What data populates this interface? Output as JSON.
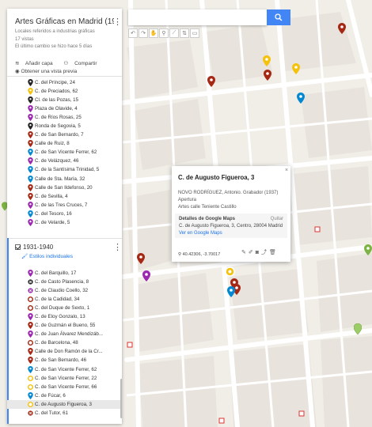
{
  "panel": {
    "title": "Artes Gráficas en Madrid (1900-1...",
    "subtitle": "Locales referidos a industrias gráficas",
    "views": "17 vistas",
    "last_change": "El último cambio se hizo hace 5 días",
    "add_layer": "Añadir capa",
    "share": "Compartir",
    "preview": "Obtener una vista previa"
  },
  "layer1": {
    "items": [
      {
        "label": "C. del Príncipe, 24",
        "color": "#222222"
      },
      {
        "label": "C. de Preciados, 62",
        "color": "#f4c20d"
      },
      {
        "label": "Cl. de las Pozas, 15",
        "color": "#222222"
      },
      {
        "label": "Plaza de Olavide, 4",
        "color": "#9c27b0"
      },
      {
        "label": "C. de Ríos Rosas, 25",
        "color": "#9c27b0"
      },
      {
        "label": "Ronda de Segovia, 5",
        "color": "#222222"
      },
      {
        "label": "C. de San Bernardo, 7",
        "color": "#a52714"
      },
      {
        "label": "Calle de Ruiz, 8",
        "color": "#a52714"
      },
      {
        "label": "C. de San Vicente Ferrer, 62",
        "color": "#0288d1"
      },
      {
        "label": "C. de Velázquez, 46",
        "color": "#9c27b0"
      },
      {
        "label": "C. de la Santísima Trinidad, 5",
        "color": "#0288d1"
      },
      {
        "label": "Calle de Sta. María, 32",
        "color": "#0288d1"
      },
      {
        "label": "Calle de San Ildefonso, 20",
        "color": "#a52714"
      },
      {
        "label": "C. de Sevilla, 4",
        "color": "#a52714"
      },
      {
        "label": "C. de las Tres Cruces, 7",
        "color": "#9c27b0"
      },
      {
        "label": "C. del Tesoro, 16",
        "color": "#0288d1"
      },
      {
        "label": "C. de Velarde, 5",
        "color": "#9c27b0"
      }
    ]
  },
  "layer2": {
    "name": "1931-1940",
    "styles": "Estilos individuales",
    "items": [
      {
        "label": "C. del Barquillo, 17",
        "color": "#9c27b0",
        "shape": "pin"
      },
      {
        "label": "C. de Casto Plasencia, 8",
        "color": "#222222",
        "shape": "x"
      },
      {
        "label": "C. de Claudio Coello, 32",
        "color": "#9c27b0",
        "shape": "x"
      },
      {
        "label": "C. de la Cadidad, 34",
        "color": "#a52714",
        "shape": "circle"
      },
      {
        "label": "C. del Duque de Sexto, 1",
        "color": "#a52714",
        "shape": "circle"
      },
      {
        "label": "C. de Eloy Gonzalo, 13",
        "color": "#9c27b0",
        "shape": "pin"
      },
      {
        "label": "C. de Guzmán el Bueno, 55",
        "color": "#a52714",
        "shape": "pin"
      },
      {
        "label": "C. de Juan Álvarez Mendizáb...",
        "color": "#9c27b0",
        "shape": "pin"
      },
      {
        "label": "C. de Barcelona, 48",
        "color": "#a52714",
        "shape": "circle"
      },
      {
        "label": "Calle de Don Ramón de la Cr...",
        "color": "#a52714",
        "shape": "pin"
      },
      {
        "label": "C. de San Bernardo, 46",
        "color": "#a52714",
        "shape": "pin"
      },
      {
        "label": "C. de San Vicente Ferrer, 62",
        "color": "#0288d1",
        "shape": "pin"
      },
      {
        "label": "C. de San Vicente Ferrer, 22",
        "color": "#f4c20d",
        "shape": "circle"
      },
      {
        "label": "C. de San Vicente Ferrer, 66",
        "color": "#f4c20d",
        "shape": "circle"
      },
      {
        "label": "C. de Fúcar, 6",
        "color": "#0288d1",
        "shape": "pin"
      },
      {
        "label": "C. de Augusto Figueroa, 3",
        "color": "#f4c20d",
        "shape": "circle"
      },
      {
        "label": "C. del Tutor, 61",
        "color": "#a52714",
        "shape": "x"
      }
    ]
  },
  "card": {
    "title": "C. de Augusto Figueroa, 3",
    "close": "×",
    "line1": "NOVO RODRÍGUEZ, Antonio. Grabador (1937)",
    "line2": "Apertura",
    "line3": "Artes calle Teniente Castillo",
    "gm_title": "Detalles de Google Maps",
    "gm_remove": "Quitar",
    "gm_address": "C. de Augusto Figueroa, 3, Centro, 28004 Madrid",
    "gm_link": "Ver en Google Maps",
    "coords": "40.42306, -3.70017"
  },
  "search": {
    "placeholder": ""
  },
  "colors": {
    "accent": "#4285f4"
  }
}
